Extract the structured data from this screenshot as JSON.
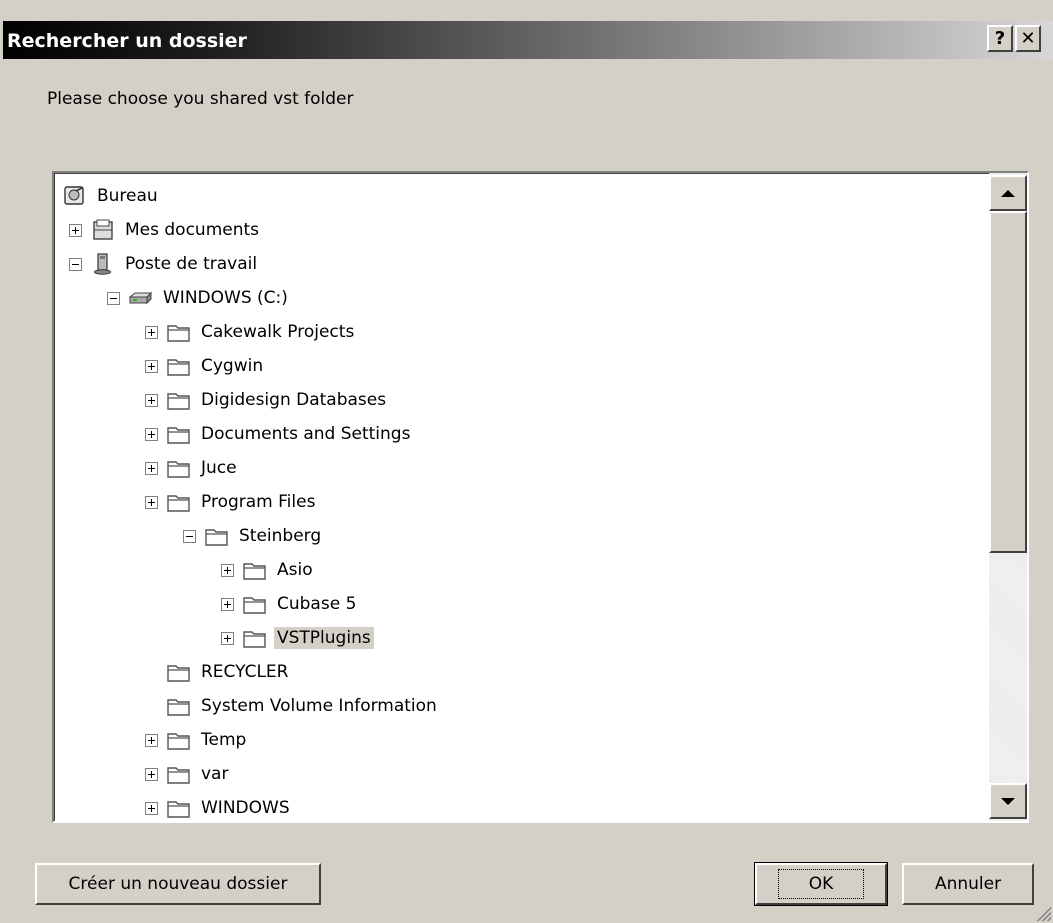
{
  "window": {
    "title": "Rechercher un dossier",
    "help_label": "?",
    "close_label": "✕"
  },
  "prompt": "Please choose you shared vst folder",
  "tree": {
    "items": [
      {
        "label": "Bureau",
        "level": 0,
        "expander": "none",
        "icon": "desktop-icon"
      },
      {
        "label": "Mes documents",
        "level": 1,
        "expander": "plus",
        "icon": "my-documents-icon"
      },
      {
        "label": "Poste de travail",
        "level": 1,
        "expander": "minus",
        "icon": "my-computer-icon"
      },
      {
        "label": "WINDOWS (C:)",
        "level": 2,
        "expander": "minus",
        "icon": "drive-icon"
      },
      {
        "label": "Cakewalk Projects",
        "level": 3,
        "expander": "plus",
        "icon": "folder-icon"
      },
      {
        "label": "Cygwin",
        "level": 3,
        "expander": "plus",
        "icon": "folder-icon"
      },
      {
        "label": "Digidesign Databases",
        "level": 3,
        "expander": "plus",
        "icon": "folder-icon"
      },
      {
        "label": "Documents and Settings",
        "level": 3,
        "expander": "plus",
        "icon": "folder-icon"
      },
      {
        "label": "Juce",
        "level": 3,
        "expander": "plus",
        "icon": "folder-icon"
      },
      {
        "label": "Program Files",
        "level": 3,
        "expander": "plus",
        "icon": "folder-icon"
      },
      {
        "label": "Steinberg",
        "level": 4,
        "expander": "minus",
        "icon": "folder-icon"
      },
      {
        "label": "Asio",
        "level": 5,
        "expander": "plus",
        "icon": "folder-icon"
      },
      {
        "label": "Cubase 5",
        "level": 5,
        "expander": "plus",
        "icon": "folder-icon"
      },
      {
        "label": "VSTPlugins",
        "level": 5,
        "expander": "plus",
        "icon": "folder-icon",
        "selected": true
      },
      {
        "label": "RECYCLER",
        "level": 3,
        "expander": "none",
        "icon": "folder-icon"
      },
      {
        "label": "System Volume Information",
        "level": 3,
        "expander": "none",
        "icon": "folder-icon"
      },
      {
        "label": "Temp",
        "level": 3,
        "expander": "plus",
        "icon": "folder-icon"
      },
      {
        "label": "var",
        "level": 3,
        "expander": "plus",
        "icon": "folder-icon"
      },
      {
        "label": "WINDOWS",
        "level": 3,
        "expander": "plus",
        "icon": "folder-icon"
      }
    ]
  },
  "buttons": {
    "new_folder": "Créer un nouveau dossier",
    "ok": "OK",
    "cancel": "Annuler"
  },
  "colors": {
    "face": "#d4d0c8",
    "selection": "#d4d0c8",
    "title_start": "#000000",
    "title_end": "#d7d7d7"
  }
}
